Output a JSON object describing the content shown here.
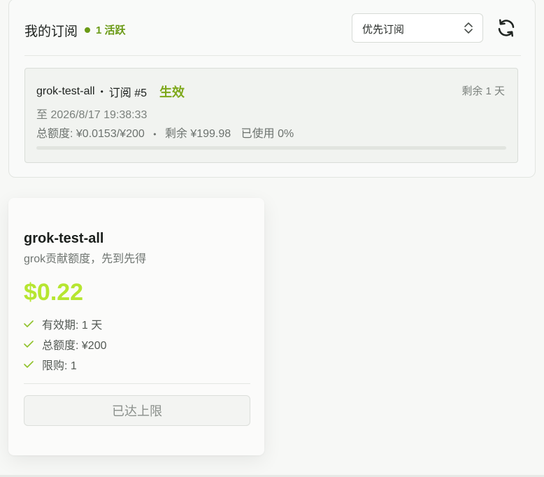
{
  "subscriptions": {
    "title": "我的订阅",
    "active_badge": "1 活跃",
    "sort_select": {
      "value": "优先订阅",
      "icon": "chevron-up-down-icon"
    },
    "refresh_icon": "refresh-icon",
    "items": [
      {
        "name": "grok-test-all",
        "separator": "•",
        "sub_id": "订阅 #5",
        "status": "生效",
        "remaining_days": "剩余 1 天",
        "expires": "至 2026/8/17 19:38:33",
        "quota": "总额度: ¥0.0153/¥200",
        "remaining_amount": "剩余 ¥199.98",
        "used": "已使用 0%",
        "usage_fraction": 0.0001
      }
    ]
  },
  "plan": {
    "name": "grok-test-all",
    "description": "grok贡献额度，先到先得",
    "price": "$0.22",
    "features": [
      "有效期: 1 天",
      "总额度: ¥200",
      "限购: 1"
    ],
    "button_label": "已达上限"
  },
  "colors": {
    "accent_green": "#7ea81b",
    "price_green": "#b6e630",
    "check_green": "#8fc22a"
  }
}
